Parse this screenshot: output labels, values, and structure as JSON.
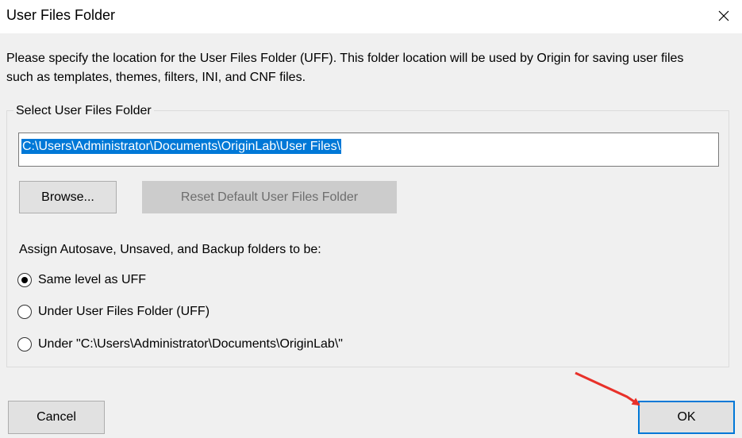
{
  "window": {
    "title": "User Files Folder",
    "close_icon": "close-icon"
  },
  "description": "Please specify the location for the User Files Folder (UFF). This folder location will be used by Origin for saving user files such as templates, themes, filters, INI, and CNF files.",
  "group": {
    "legend": "Select User Files Folder",
    "path_value": "C:\\Users\\Administrator\\Documents\\OriginLab\\User Files\\",
    "browse_label": "Browse...",
    "reset_label": "Reset Default User Files Folder",
    "assign_label": "Assign Autosave, Unsaved, and Backup folders to be:",
    "options": [
      {
        "label": "Same level as UFF",
        "checked": true
      },
      {
        "label": "Under User Files Folder (UFF)",
        "checked": false
      },
      {
        "label": "Under \"C:\\Users\\Administrator\\Documents\\OriginLab\\\"",
        "checked": false
      }
    ]
  },
  "footer": {
    "cancel_label": "Cancel",
    "ok_label": "OK"
  },
  "annotation": {
    "arrow_color": "#e8312a"
  },
  "colors": {
    "selection": "#0078d7",
    "default_button_border": "#0078d7"
  }
}
